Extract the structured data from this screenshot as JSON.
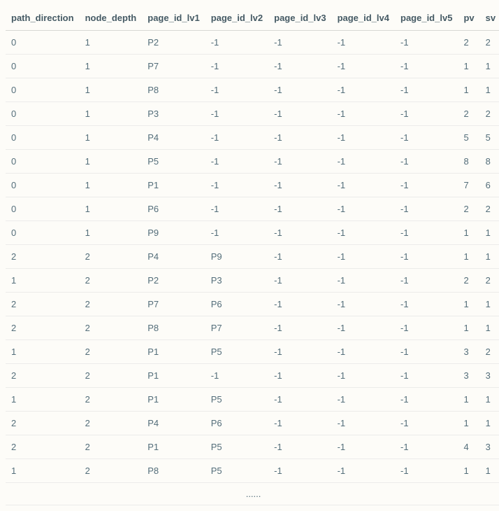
{
  "table": {
    "headers": [
      "path_direction",
      "node_depth",
      "page_id_lv1",
      "page_id_lv2",
      "page_id_lv3",
      "page_id_lv4",
      "page_id_lv5",
      "pv",
      "sv"
    ],
    "rows": [
      [
        "0",
        "1",
        "P2",
        "-1",
        "-1",
        "-1",
        "-1",
        "2",
        "2"
      ],
      [
        "0",
        "1",
        "P7",
        "-1",
        "-1",
        "-1",
        "-1",
        "1",
        "1"
      ],
      [
        "0",
        "1",
        "P8",
        "-1",
        "-1",
        "-1",
        "-1",
        "1",
        "1"
      ],
      [
        "0",
        "1",
        "P3",
        "-1",
        "-1",
        "-1",
        "-1",
        "2",
        "2"
      ],
      [
        "0",
        "1",
        "P4",
        "-1",
        "-1",
        "-1",
        "-1",
        "5",
        "5"
      ],
      [
        "0",
        "1",
        "P5",
        "-1",
        "-1",
        "-1",
        "-1",
        "8",
        "8"
      ],
      [
        "0",
        "1",
        "P1",
        "-1",
        "-1",
        "-1",
        "-1",
        "7",
        "6"
      ],
      [
        "0",
        "1",
        "P6",
        "-1",
        "-1",
        "-1",
        "-1",
        "2",
        "2"
      ],
      [
        "0",
        "1",
        "P9",
        "-1",
        "-1",
        "-1",
        "-1",
        "1",
        "1"
      ],
      [
        "2",
        "2",
        "P4",
        "P9",
        "-1",
        "-1",
        "-1",
        "1",
        "1"
      ],
      [
        "1",
        "2",
        "P2",
        "P3",
        "-1",
        "-1",
        "-1",
        "2",
        "2"
      ],
      [
        "2",
        "2",
        "P7",
        "P6",
        "-1",
        "-1",
        "-1",
        "1",
        "1"
      ],
      [
        "2",
        "2",
        "P8",
        "P7",
        "-1",
        "-1",
        "-1",
        "1",
        "1"
      ],
      [
        "1",
        "2",
        "P1",
        "P5",
        "-1",
        "-1",
        "-1",
        "3",
        "2"
      ],
      [
        "2",
        "2",
        "P1",
        "-1",
        "-1",
        "-1",
        "-1",
        "3",
        "3"
      ],
      [
        "1",
        "2",
        "P1",
        "P5",
        "-1",
        "-1",
        "-1",
        "1",
        "1"
      ],
      [
        "2",
        "2",
        "P4",
        "P6",
        "-1",
        "-1",
        "-1",
        "1",
        "1"
      ],
      [
        "2",
        "2",
        "P1",
        "P5",
        "-1",
        "-1",
        "-1",
        "4",
        "3"
      ],
      [
        "1",
        "2",
        "P8",
        "P5",
        "-1",
        "-1",
        "-1",
        "1",
        "1"
      ]
    ],
    "ellipsis": "......"
  }
}
